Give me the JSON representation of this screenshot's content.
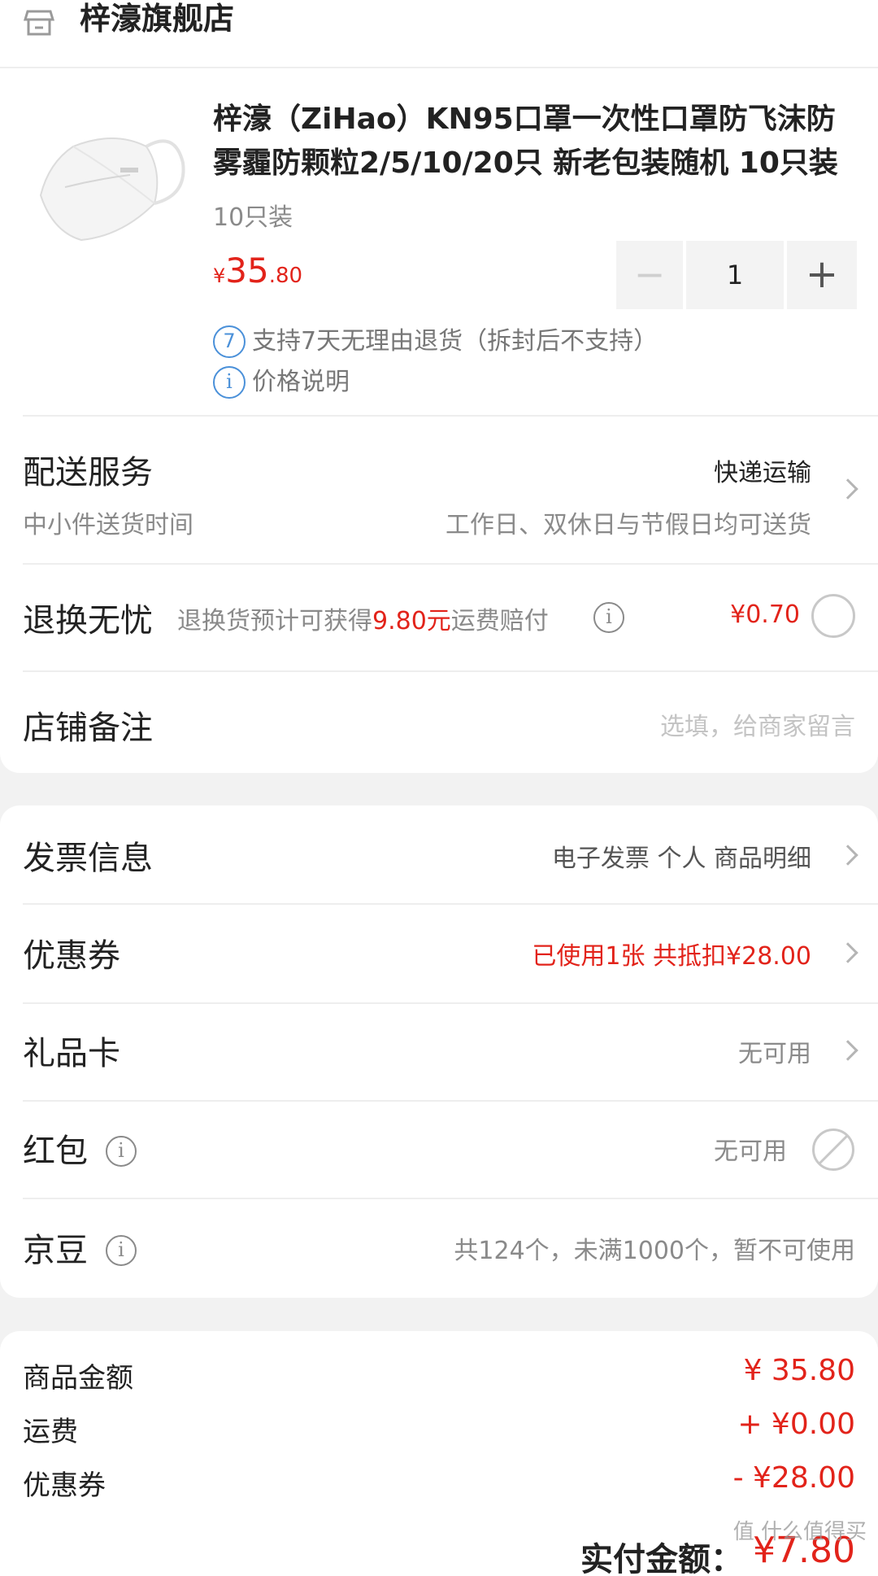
{
  "shop": {
    "name": "梓濠旗舰店",
    "icon": "store-icon"
  },
  "product": {
    "title": "梓濠（ZiHao）KN95口罩一次性口罩防飞沫防雾霾防颗粒2/5/10/20只 新老包装随机 10只装",
    "spec": "10只装",
    "price_symbol": "¥",
    "price_int": "35",
    "price_dec": ".80",
    "quantity": "1",
    "minus_label": "−",
    "plus_label": "+",
    "return_badge": "7",
    "return_text": "支持7天无理由退货（拆封后不支持）",
    "price_note_icon": "i",
    "price_note": "价格说明"
  },
  "delivery": {
    "label": "配送服务",
    "method": "快递运输",
    "sub_label": "中小件送货时间",
    "sub_value": "工作日、双休日与节假日均可送货"
  },
  "return_service": {
    "label": "退换无忧",
    "desc_prefix": "退换货预计可获得",
    "desc_amount": "9.80元",
    "desc_suffix": "运费赔付",
    "price": "¥0.70"
  },
  "remark": {
    "label": "店铺备注",
    "placeholder": "选填，给商家留言"
  },
  "invoice": {
    "label": "发票信息",
    "value": "电子发票 个人 商品明细"
  },
  "coupon": {
    "label": "优惠券",
    "value": "已使用1张 共抵扣¥28.00"
  },
  "gift_card": {
    "label": "礼品卡",
    "value": "无可用"
  },
  "red_packet": {
    "label": "红包",
    "value": "无可用"
  },
  "jingdou": {
    "label": "京豆",
    "value": "共124个，未满1000个，暂不可使用"
  },
  "summary": {
    "goods_label": "商品金额",
    "goods_value": "¥ 35.80",
    "shipping_label": "运费",
    "shipping_value": "+ ¥0.00",
    "coupon_label": "优惠券",
    "coupon_value": "- ¥28.00",
    "total_label": "实付金额：",
    "total_value": "¥7.80"
  },
  "watermark": "值 什么值得买",
  "colors": {
    "accent": "#e2231a",
    "info_blue": "#4a90d9"
  }
}
